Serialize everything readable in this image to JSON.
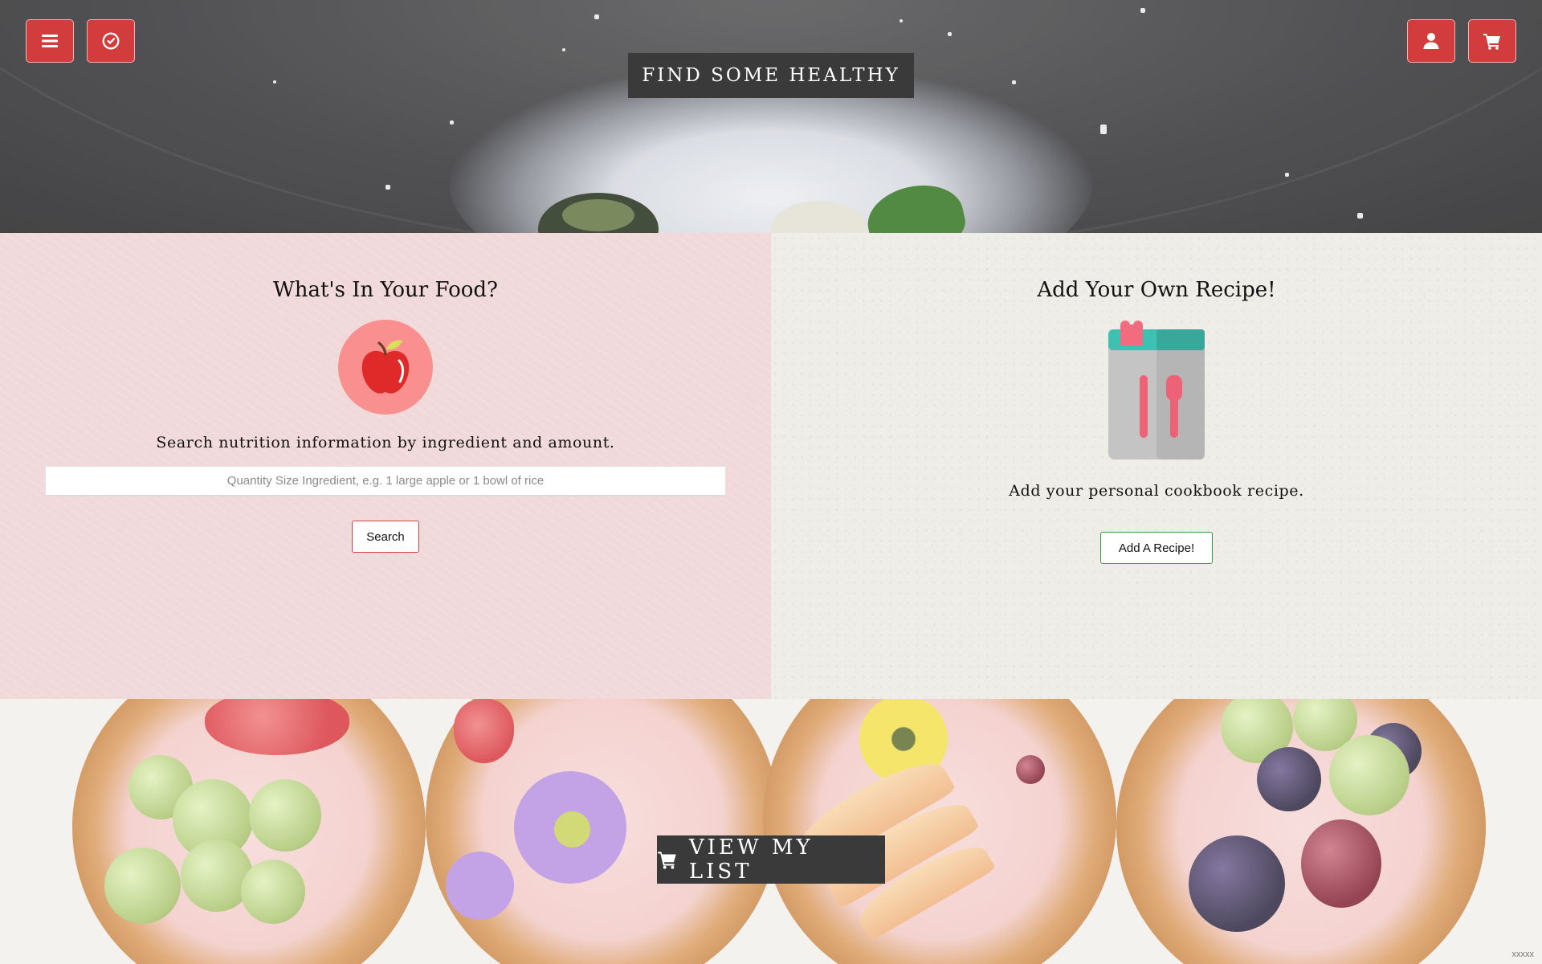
{
  "header": {
    "title": "FIND SOME HEALTHY",
    "icons": {
      "menu": "menu-icon",
      "check": "check-circle-icon",
      "user": "user-icon",
      "cart": "cart-icon"
    },
    "accent": "#d23c3c"
  },
  "nutrition": {
    "heading": "What's In Your Food?",
    "icon": "apple-icon",
    "description": "Search nutrition information by ingredient and amount.",
    "input_placeholder": "Quantity Size Ingredient, e.g. 1 large apple or 1 bowl of rice",
    "input_value": "",
    "button_label": "Search",
    "button_border_color": "#d94040"
  },
  "recipe": {
    "heading": "Add Your Own Recipe!",
    "icon": "cookbook-icon",
    "description": "Add your personal cookbook recipe.",
    "button_label": "Add A Recipe!",
    "button_border_color": "#3a9a4a"
  },
  "footer": {
    "view_list_label": "VIEW MY LIST",
    "cart_icon": "cart-icon",
    "mark": "xxxxx"
  }
}
